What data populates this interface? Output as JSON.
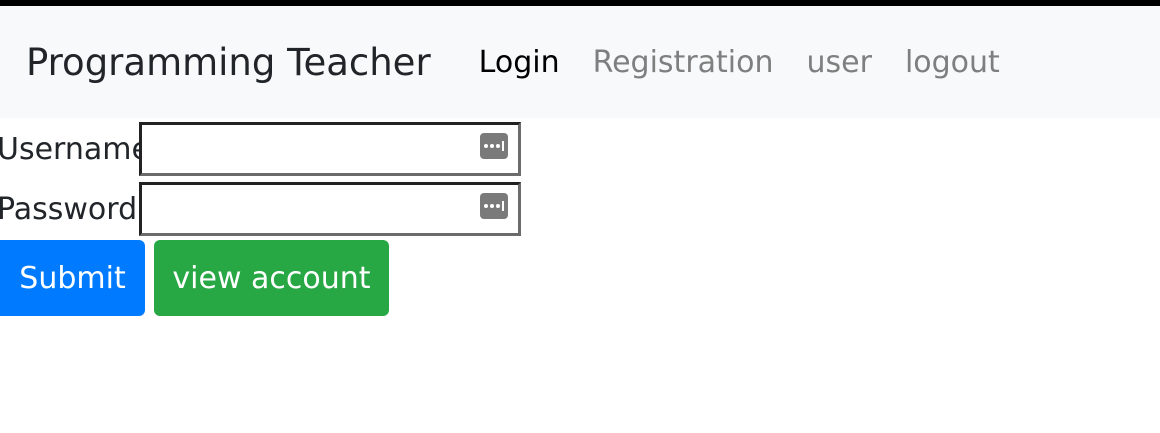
{
  "navbar": {
    "brand": "Programming Teacher",
    "links": [
      {
        "label": "Login"
      },
      {
        "label": "Registration"
      },
      {
        "label": "user"
      },
      {
        "label": "logout"
      }
    ]
  },
  "form": {
    "username_label": "Username",
    "username_value": "",
    "password_label": "Password",
    "password_value": ""
  },
  "buttons": {
    "submit": "Submit",
    "view_account": "view account"
  },
  "colors": {
    "primary": "#007bff",
    "success": "#28a745",
    "navbar_bg": "#f8f9fa",
    "nav_link_inactive": "#7f7f7f"
  },
  "icons": {
    "field_autofill": "password-manager-icon"
  }
}
